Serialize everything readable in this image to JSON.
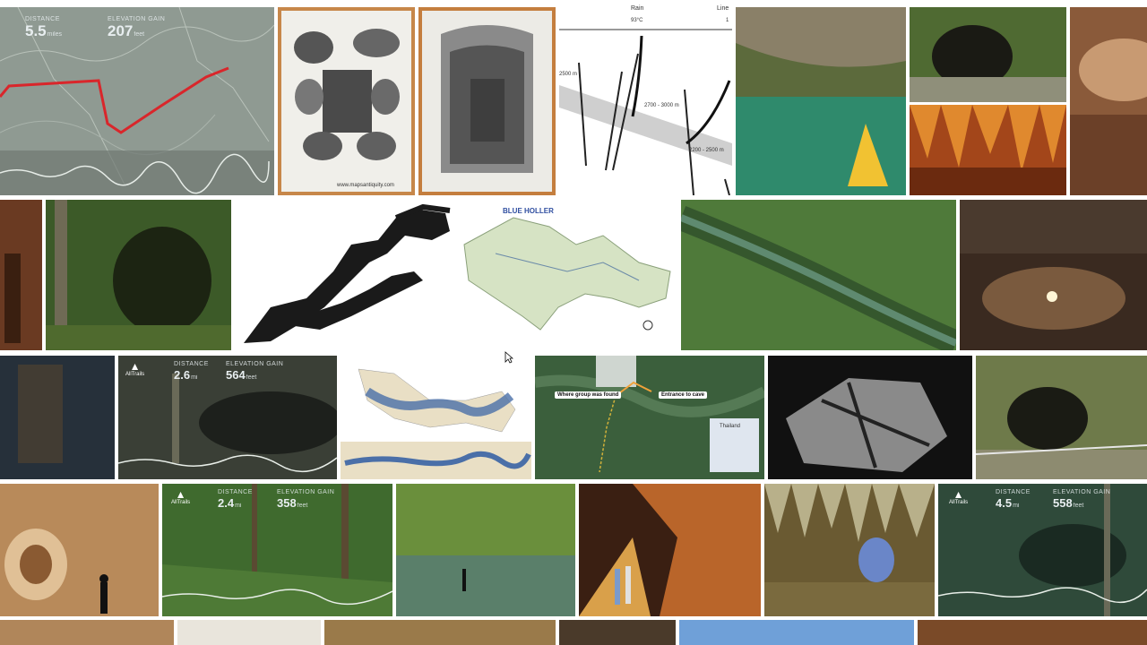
{
  "trail_cards": {
    "top_left": {
      "distance_label": "DISTANCE",
      "distance": "5.5",
      "distance_unit": "miles",
      "gain_label": "ELEVATION GAIN",
      "gain": "207",
      "gain_unit": "feet"
    },
    "row3_card": {
      "distance_label": "DISTANCE",
      "distance": "2.6",
      "distance_unit": "mi",
      "gain_label": "ELEVATION GAIN",
      "gain": "564",
      "gain_unit": "feet"
    },
    "row4_card_a": {
      "distance_label": "DISTANCE",
      "distance": "2.4",
      "distance_unit": "mi",
      "gain_label": "ELEVATION GAIN",
      "gain": "358",
      "gain_unit": "feet"
    },
    "row4_card_b": {
      "distance_label": "DISTANCE",
      "distance": "4.5",
      "distance_unit": "mi",
      "gain_label": "ELEVATION GAIN",
      "gain": "558",
      "gain_unit": "feet"
    }
  },
  "brand": {
    "name": "AllTrails"
  },
  "engraving": {
    "url": "www.mapsantiquity.com"
  },
  "geology_diagram": {
    "col1": "Rain",
    "col2": "Line",
    "temp": "93°C",
    "depth1": "2500 m",
    "depth2": "2700 - 3000 m",
    "depth3": "2200 - 2500 m",
    "col2_val": "1"
  },
  "cave_map": {
    "title": "BLUE HOLLER"
  },
  "location_map": {
    "callout_found": "Where group was found",
    "callout_entrance": "Entrance to cave",
    "inset_label": "Thailand"
  },
  "colors": {
    "route_red": "#d9262b",
    "map_bg": "#9aa49c",
    "moss": "#3f5a2a",
    "cave_warm": "#b77a3c"
  }
}
